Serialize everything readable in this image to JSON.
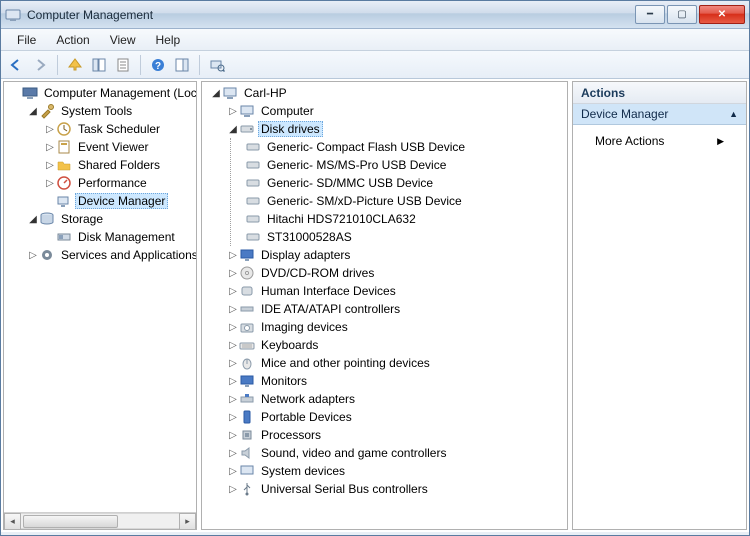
{
  "window": {
    "title": "Computer Management"
  },
  "menu": {
    "file": "File",
    "action": "Action",
    "view": "View",
    "help": "Help"
  },
  "left_tree": {
    "root": "Computer Management (Local",
    "system_tools": "System Tools",
    "task_scheduler": "Task Scheduler",
    "event_viewer": "Event Viewer",
    "shared_folders": "Shared Folders",
    "performance": "Performance",
    "device_manager": "Device Manager",
    "storage": "Storage",
    "disk_management": "Disk Management",
    "services_apps": "Services and Applications"
  },
  "mid_tree": {
    "root": "Carl-HP",
    "computer": "Computer",
    "disk_drives": "Disk drives",
    "disks": {
      "d0": "Generic- Compact Flash USB Device",
      "d1": "Generic- MS/MS-Pro USB Device",
      "d2": "Generic- SD/MMC USB Device",
      "d3": "Generic- SM/xD-Picture USB Device",
      "d4": "Hitachi HDS721010CLA632",
      "d5": "ST31000528AS"
    },
    "display_adapters": "Display adapters",
    "dvd": "DVD/CD-ROM drives",
    "hid": "Human Interface Devices",
    "ide": "IDE ATA/ATAPI controllers",
    "imaging": "Imaging devices",
    "keyboards": "Keyboards",
    "mice": "Mice and other pointing devices",
    "monitors": "Monitors",
    "network": "Network adapters",
    "portable": "Portable Devices",
    "processors": "Processors",
    "sound": "Sound, video and game controllers",
    "system_devices": "System devices",
    "usb": "Universal Serial Bus controllers"
  },
  "actions": {
    "header": "Actions",
    "section": "Device Manager",
    "more": "More Actions"
  }
}
